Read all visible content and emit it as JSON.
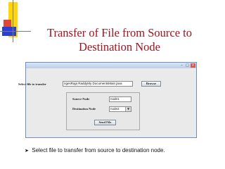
{
  "slide": {
    "title_line1": "Transfer of File from Source to",
    "title_line2": "Destination Node",
    "bullet_text": "Select file to transfer from source to destination node.",
    "title_color": "#a3121d"
  },
  "window": {
    "controls": [
      "minimize-icon",
      "maximize-icon",
      "close-icon"
    ],
    "select_label": "Select file to transfer",
    "file_path": "ngesRaja RaddyMy DocumentsMain java",
    "browse_label": "Browse",
    "source_label": "Source Node",
    "source_value": "node1",
    "destination_label": "Destination Node",
    "destination_value": "node2",
    "send_label": "Send File"
  },
  "icons": {
    "bullet": "arrow-bullet-icon",
    "dropdown": "chevron-down-icon"
  }
}
